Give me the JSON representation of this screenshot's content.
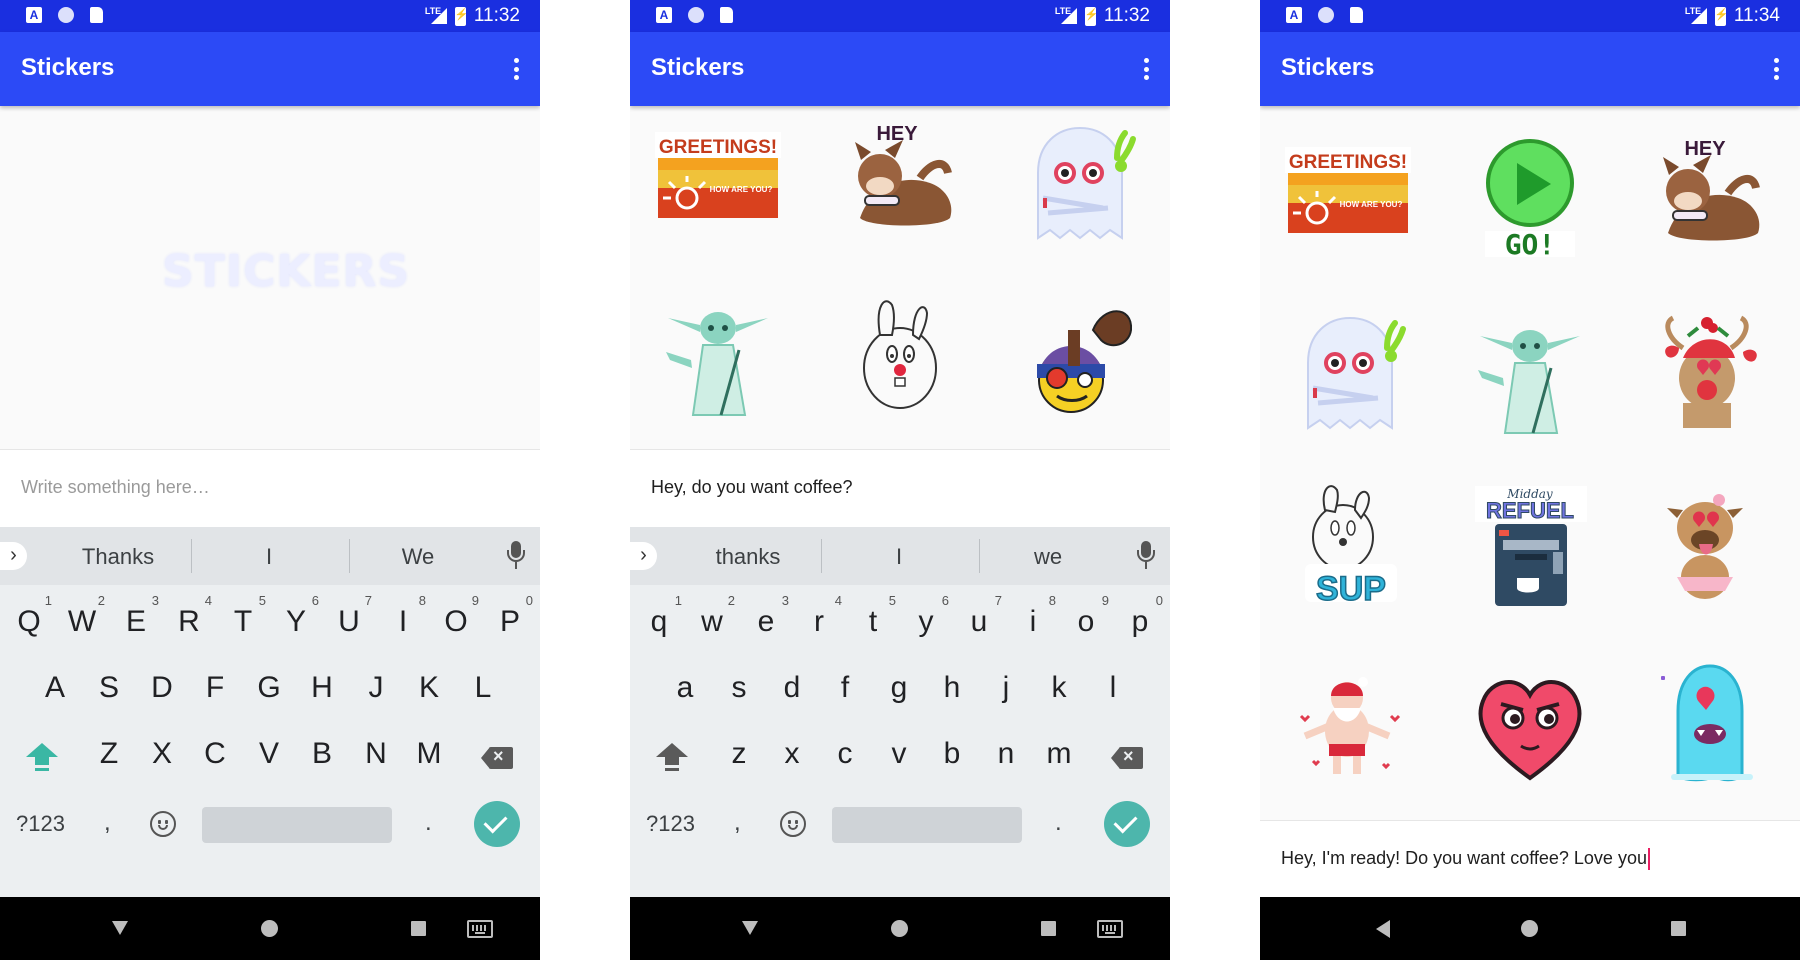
{
  "screens": [
    {
      "status": {
        "time": "11:32",
        "network": "LTE"
      },
      "appbar": {
        "title": "Stickers"
      },
      "watermark": "STICKERS",
      "input": {
        "value": "",
        "placeholder": "Write something here…"
      },
      "suggestions": [
        "Thanks",
        "I",
        "We"
      ],
      "keys": {
        "row1": [
          "Q",
          "W",
          "E",
          "R",
          "T",
          "Y",
          "U",
          "I",
          "O",
          "P"
        ],
        "row2": [
          "A",
          "S",
          "D",
          "F",
          "G",
          "H",
          "J",
          "K",
          "L"
        ],
        "row3": [
          "Z",
          "X",
          "C",
          "V",
          "B",
          "N",
          "M"
        ]
      }
    },
    {
      "status": {
        "time": "11:32",
        "network": "LTE"
      },
      "appbar": {
        "title": "Stickers"
      },
      "input": {
        "value": "Hey, do you want coffee?",
        "placeholder": ""
      },
      "suggestions": [
        "thanks",
        "I",
        "we"
      ],
      "keys": {
        "row1": [
          "q",
          "w",
          "e",
          "r",
          "t",
          "y",
          "u",
          "i",
          "o",
          "p"
        ],
        "row2": [
          "a",
          "s",
          "d",
          "f",
          "g",
          "h",
          "j",
          "k",
          "l"
        ],
        "row3": [
          "z",
          "x",
          "c",
          "v",
          "b",
          "n",
          "m"
        ]
      },
      "stickers": [
        "greetings-sticker",
        "hey-dog-sticker",
        "ghost-sticker",
        "yoda-sticker",
        "bunny-sticker",
        "coffee-emoji-sticker"
      ]
    },
    {
      "status": {
        "time": "11:34",
        "network": "LTE"
      },
      "appbar": {
        "title": "Stickers"
      },
      "input": {
        "value": "Hey, I'm ready! Do you want coffee? Love you",
        "placeholder": ""
      },
      "stickers": [
        "greetings-sticker",
        "go-sticker",
        "hey-dog-sticker",
        "ghost-sticker",
        "yoda-sticker",
        "reindeer-sticker",
        "sup-bunny-sticker",
        "midday-refuel-sticker",
        "pug-tutu-sticker",
        "santa-sticker",
        "heart-face-sticker",
        "blue-monster-sticker"
      ]
    }
  ],
  "number_hints": [
    "1",
    "2",
    "3",
    "4",
    "5",
    "6",
    "7",
    "8",
    "9",
    "0"
  ],
  "keyboard_labels": {
    "symbols": "?123",
    "comma": ",",
    "period": "."
  },
  "sticker_text": {
    "greetings": "GREETINGS!",
    "how_are_you": "HOW ARE YOU?",
    "hey": "HEY",
    "go": "GO!",
    "sup": "SUP",
    "midday": "Midday",
    "refuel": "REFUEL"
  },
  "colors": {
    "statusbar": "#1a2fe0",
    "appbar": "#2c4af6",
    "keyboard": "#eceff1",
    "enter_key": "#4db6ac",
    "caret": "#e91e63"
  }
}
